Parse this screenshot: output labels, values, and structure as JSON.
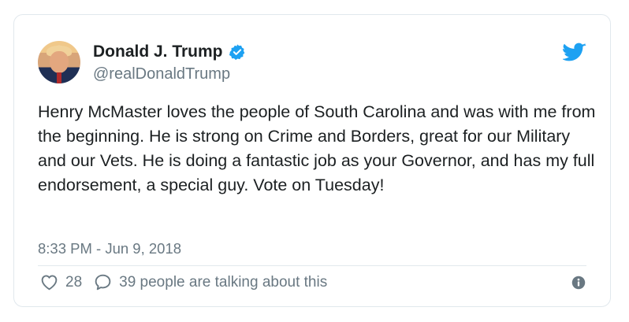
{
  "tweet": {
    "author_name": "Donald J. Trump",
    "author_handle": "@realDonaldTrump",
    "text": "Henry McMaster loves the people of South Carolina and was with me from the beginning. He is strong on Crime and Borders, great for our Military and our Vets. He is doing a fantastic job as your Governor, and has my full endorsement, a special guy. Vote on Tuesday!",
    "timestamp": "8:33 PM - Jun 9, 2018",
    "like_count": "28",
    "talking_text": "39 people are talking about this"
  },
  "icons": {
    "verified": "verified-badge-icon",
    "brand": "twitter-bird-icon",
    "like": "heart-icon",
    "reply": "speech-bubble-icon",
    "info": "info-icon"
  },
  "colors": {
    "accent": "#1da1f2",
    "text": "#1c2022",
    "muted": "#697882",
    "border": "#e1e8ed"
  }
}
